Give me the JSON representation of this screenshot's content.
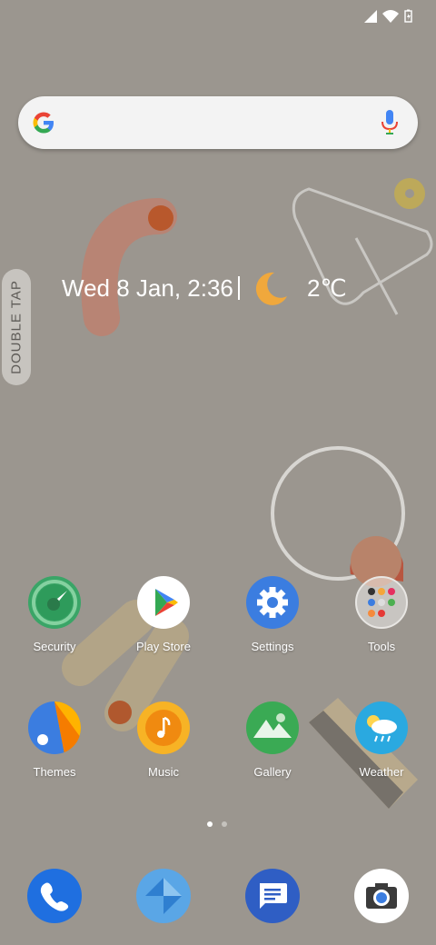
{
  "status_bar": {
    "icons": [
      "signal-icon",
      "wifi-icon",
      "battery-icon"
    ]
  },
  "search": {
    "icons": [
      "google-logo",
      "mic-icon"
    ]
  },
  "double_tap": {
    "label": "DOUBLE TAP"
  },
  "widget": {
    "datetime": "Wed 8 Jan, 2:36",
    "weather_icon": "moon-icon",
    "temperature": "2℃"
  },
  "apps_row1": [
    {
      "label": "Security",
      "icon": "security-icon"
    },
    {
      "label": "Play Store",
      "icon": "play-store-icon"
    },
    {
      "label": "Settings",
      "icon": "settings-icon"
    },
    {
      "label": "Tools",
      "icon": "tools-folder-icon"
    }
  ],
  "apps_row2": [
    {
      "label": "Themes",
      "icon": "themes-icon"
    },
    {
      "label": "Music",
      "icon": "music-icon"
    },
    {
      "label": "Gallery",
      "icon": "gallery-icon"
    },
    {
      "label": "Weather",
      "icon": "weather-icon"
    }
  ],
  "page_indicator": {
    "pages": 2,
    "current": 1
  },
  "dock": [
    {
      "icon": "phone-icon"
    },
    {
      "icon": "browser-icon"
    },
    {
      "icon": "messages-icon"
    },
    {
      "icon": "camera-icon"
    }
  ],
  "colors": {
    "wallpaper": "#9b968f",
    "accent_orange": "#f0a83c",
    "play_green": "#34a853"
  }
}
